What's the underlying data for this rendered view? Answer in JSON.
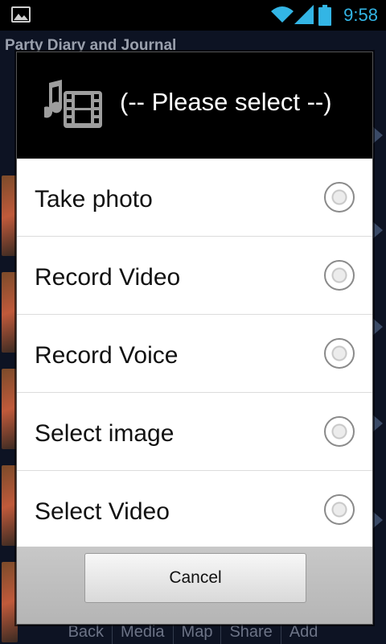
{
  "status_bar": {
    "time": "9:58",
    "icons": [
      "image-notification-icon",
      "wifi-icon",
      "signal-icon",
      "battery-icon"
    ]
  },
  "app": {
    "title": "Party Diary and Journal",
    "bottom_nav": [
      "Back",
      "Media",
      "Map",
      "Share",
      "Add"
    ]
  },
  "dialog": {
    "title": "(-- Please select --)",
    "icon": "media-music-film-icon",
    "options": [
      {
        "label": "Take photo"
      },
      {
        "label": "Record Video"
      },
      {
        "label": "Record Voice"
      },
      {
        "label": "Select image"
      },
      {
        "label": "Select Video"
      }
    ],
    "cancel_label": "Cancel"
  }
}
